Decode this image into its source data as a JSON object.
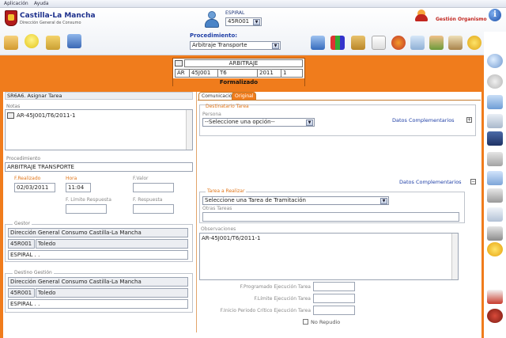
{
  "menu": {
    "items": [
      "Aplicación",
      "Ayuda"
    ]
  },
  "brand": {
    "title": "Castilla-La Mancha",
    "subtitle": "Dirección General de Consumo",
    "app_name": "Gestión Organismo"
  },
  "header": {
    "espiral_label": "ESPIRAL",
    "espiral_value": "45R001",
    "procedimiento_label": "Procedimiento:",
    "procedimiento_value": "Arbitraje Transporte"
  },
  "expediente": {
    "title": "ARBITRAJE",
    "cells": [
      "AR",
      "45J001",
      "T6",
      "2011",
      "1"
    ],
    "status": "Formalizado"
  },
  "task": {
    "heading": "SR6A6. Asignar Tarea",
    "notas_label": "Notas",
    "notas_value": "AR-45J001/T6/2011-1",
    "procedimiento_label": "Procedimiento",
    "procedimiento_value": "ARBITRAJE TRANSPORTE",
    "f_realizado_label": "F.Realizado",
    "f_realizado_value": "02/03/2011",
    "hora_label": "Hora",
    "hora_value": "11:04",
    "f_valor_label": "F.Valor",
    "f_limite_label": "F. Límite Respuesta",
    "f_respuesta_label": "F. Respuesta"
  },
  "gestor": {
    "label": "Gestor",
    "name": "Dirección General Consumo Castilla-La Mancha",
    "code": "45R001",
    "city": "Toledo",
    "extra": "ESPIRAL . ."
  },
  "destino": {
    "label": "Destino Gestión",
    "name": "Dirección General Consumo Castilla-La Mancha",
    "code": "45R001",
    "city": "Toledo",
    "extra": "ESPIRAL . ."
  },
  "tabs": [
    "Comunicación",
    "Original"
  ],
  "destinatario": {
    "label": "Destinatario Tarea",
    "persona_label": "Persona",
    "persona_value": "--Seleccione una opción--",
    "datos_link": "Datos Complementarios"
  },
  "datos_link2": "Datos Complementarios",
  "tarea": {
    "label": "Tarea a Realizar",
    "select_value": "Seleccione una Tarea de Tramitación",
    "otras_label": "Otras Tareas"
  },
  "observaciones": {
    "label": "Observaciones",
    "value": "AR-45J001/T6/2011-1"
  },
  "fechas": {
    "programado": "F.Programado Ejecución Tarea",
    "limite": "F.Límite Ejecución Tarea",
    "inicio": "F.Inicio Periodo Crítico Ejecución Tarea",
    "no_repudio": "No Repudio"
  },
  "colors": {
    "accent": "#f07c1c",
    "label": "#e1761a",
    "link": "#1f3fa6"
  },
  "icons": [
    "home-icon",
    "lightbulb-icon",
    "folder-icon",
    "exit-icon",
    "books-icon",
    "calendar-icon",
    "globe-icon",
    "tools-icon",
    "calculator-icon",
    "gear-icon",
    "search-icon",
    "printer-icon",
    "clip-icon",
    "cancel-icon",
    "info-icon"
  ]
}
